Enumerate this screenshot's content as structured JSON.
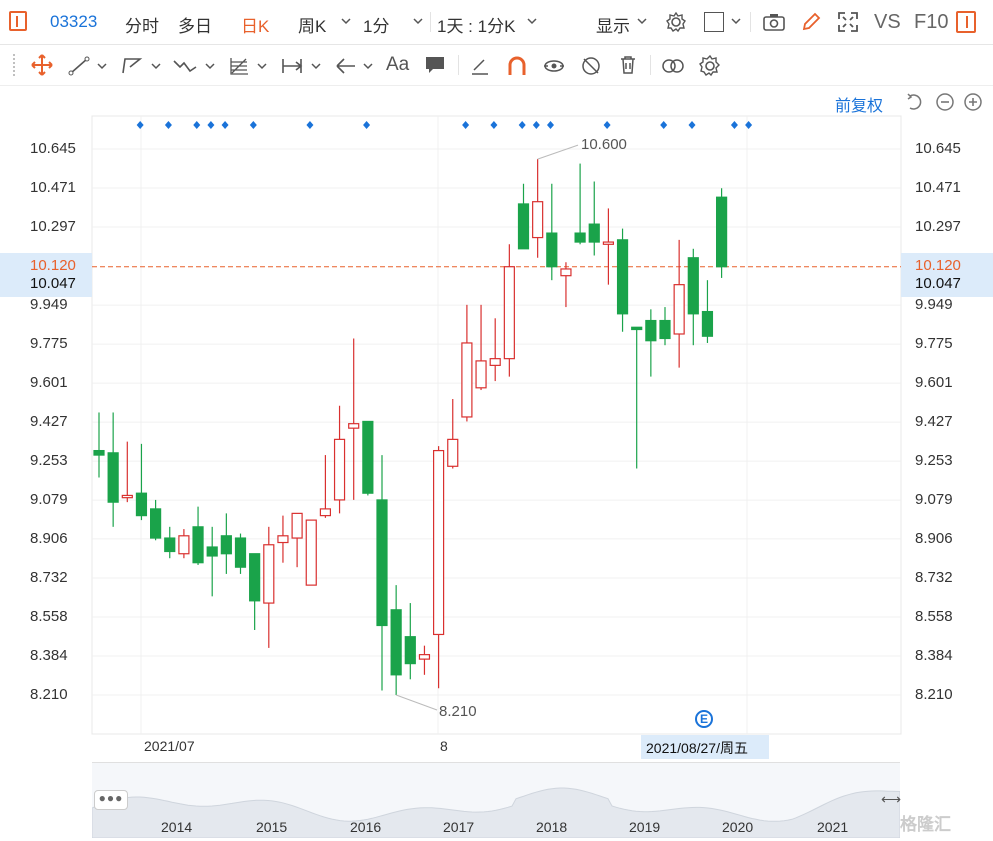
{
  "toolbar": {
    "code": "03323",
    "tabs": [
      "分时",
      "多日",
      "日K",
      "周K",
      "1分",
      "1天 : 1分K",
      "显示"
    ],
    "vs_label": "VS",
    "f10_label": "F10"
  },
  "drawing_tools": [
    "move",
    "line",
    "polyline",
    "wave",
    "fib",
    "measure",
    "arrow",
    "text",
    "note",
    "pen",
    "magnet",
    "eye",
    "hide",
    "trash",
    "link",
    "settings"
  ],
  "adjust_label": "前复权",
  "price_axis_ticks": [
    "10.645",
    "10.471",
    "10.297",
    "10.120",
    "10.047",
    "9.949",
    "9.775",
    "9.601",
    "9.427",
    "9.253",
    "9.079",
    "8.906",
    "8.732",
    "8.558",
    "8.384",
    "8.210"
  ],
  "current_price": "10.120",
  "crosshair_price": "10.047",
  "crosshair_date": "2021/08/27/周五",
  "high_label": "10.600",
  "low_label": "8.210",
  "x_axis_labels": [
    "2021/07",
    "8"
  ],
  "navigator_years": [
    "2014",
    "2015",
    "2016",
    "2017",
    "2018",
    "2019",
    "2020",
    "2021"
  ],
  "event_marker": "E",
  "watermark": "格隆汇",
  "colors": {
    "up": "#d9302f",
    "down": "#1aa34a",
    "accent": "#1a73d9",
    "highlight": "#e8612c"
  },
  "chart_data": {
    "type": "candlestick",
    "title": "",
    "ylim": [
      8.12,
      10.73
    ],
    "price_ticks": [
      8.21,
      8.384,
      8.558,
      8.732,
      8.906,
      9.079,
      9.253,
      9.427,
      9.601,
      9.775,
      9.949,
      10.12,
      10.297,
      10.471,
      10.645
    ],
    "current_price": 10.12,
    "candles": [
      {
        "o": 9.3,
        "h": 9.47,
        "l": 9.18,
        "c": 9.28
      },
      {
        "o": 9.29,
        "h": 9.47,
        "l": 8.96,
        "c": 9.07
      },
      {
        "o": 9.09,
        "h": 9.34,
        "l": 9.07,
        "c": 9.1
      },
      {
        "o": 9.11,
        "h": 9.33,
        "l": 8.99,
        "c": 9.01
      },
      {
        "o": 9.04,
        "h": 9.08,
        "l": 8.9,
        "c": 8.91
      },
      {
        "o": 8.91,
        "h": 8.96,
        "l": 8.82,
        "c": 8.85
      },
      {
        "o": 8.84,
        "h": 8.95,
        "l": 8.82,
        "c": 8.92
      },
      {
        "o": 8.96,
        "h": 9.05,
        "l": 8.79,
        "c": 8.8
      },
      {
        "o": 8.87,
        "h": 8.96,
        "l": 8.65,
        "c": 8.83
      },
      {
        "o": 8.92,
        "h": 9.02,
        "l": 8.75,
        "c": 8.84
      },
      {
        "o": 8.91,
        "h": 8.93,
        "l": 8.75,
        "c": 8.78
      },
      {
        "o": 8.84,
        "h": 8.84,
        "l": 8.5,
        "c": 8.63
      },
      {
        "o": 8.62,
        "h": 8.96,
        "l": 8.42,
        "c": 8.88
      },
      {
        "o": 8.89,
        "h": 9.01,
        "l": 8.8,
        "c": 8.92
      },
      {
        "o": 8.91,
        "h": 9.01,
        "l": 8.78,
        "c": 9.02
      },
      {
        "o": 8.7,
        "h": 8.98,
        "l": 8.7,
        "c": 8.99
      },
      {
        "o": 9.01,
        "h": 9.28,
        "l": 9.0,
        "c": 9.04
      },
      {
        "o": 9.08,
        "h": 9.5,
        "l": 9.02,
        "c": 9.35
      },
      {
        "o": 9.4,
        "h": 9.8,
        "l": 9.08,
        "c": 9.42
      },
      {
        "o": 9.43,
        "h": 9.43,
        "l": 9.1,
        "c": 9.11
      },
      {
        "o": 9.08,
        "h": 9.28,
        "l": 8.23,
        "c": 8.52
      },
      {
        "o": 8.59,
        "h": 8.7,
        "l": 8.21,
        "c": 8.3
      },
      {
        "o": 8.47,
        "h": 8.62,
        "l": 8.28,
        "c": 8.35
      },
      {
        "o": 8.37,
        "h": 8.43,
        "l": 8.3,
        "c": 8.39
      },
      {
        "o": 8.48,
        "h": 9.32,
        "l": 8.24,
        "c": 9.3
      },
      {
        "o": 9.23,
        "h": 9.53,
        "l": 9.22,
        "c": 9.35
      },
      {
        "o": 9.45,
        "h": 9.95,
        "l": 9.43,
        "c": 9.78
      },
      {
        "o": 9.58,
        "h": 9.95,
        "l": 9.57,
        "c": 9.7
      },
      {
        "o": 9.68,
        "h": 9.89,
        "l": 9.61,
        "c": 9.71
      },
      {
        "o": 9.71,
        "h": 10.22,
        "l": 9.63,
        "c": 10.12
      },
      {
        "o": 10.4,
        "h": 10.49,
        "l": 10.2,
        "c": 10.2
      },
      {
        "o": 10.25,
        "h": 10.6,
        "l": 10.16,
        "c": 10.41
      },
      {
        "o": 10.27,
        "h": 10.49,
        "l": 10.06,
        "c": 10.12
      },
      {
        "o": 10.08,
        "h": 10.14,
        "l": 9.94,
        "c": 10.11
      },
      {
        "o": 10.27,
        "h": 10.58,
        "l": 10.22,
        "c": 10.23
      },
      {
        "o": 10.31,
        "h": 10.5,
        "l": 10.17,
        "c": 10.23
      },
      {
        "o": 10.22,
        "h": 10.38,
        "l": 10.04,
        "c": 10.23
      },
      {
        "o": 10.24,
        "h": 10.29,
        "l": 9.83,
        "c": 9.91
      },
      {
        "o": 9.85,
        "h": 9.85,
        "l": 9.22,
        "c": 9.84
      },
      {
        "o": 9.88,
        "h": 9.93,
        "l": 9.63,
        "c": 9.79
      },
      {
        "o": 9.88,
        "h": 9.94,
        "l": 9.77,
        "c": 9.8
      },
      {
        "o": 9.82,
        "h": 10.24,
        "l": 9.67,
        "c": 10.04
      },
      {
        "o": 10.16,
        "h": 10.2,
        "l": 9.77,
        "c": 9.91
      },
      {
        "o": 9.92,
        "h": 10.06,
        "l": 9.78,
        "c": 9.81
      },
      {
        "o": 10.43,
        "h": 10.47,
        "l": 10.07,
        "c": 10.12
      }
    ],
    "event_dot_candles": [
      1,
      3,
      5,
      6,
      7,
      9,
      13,
      17,
      24,
      26,
      28,
      29,
      30,
      34,
      38,
      40,
      43,
      44
    ]
  }
}
